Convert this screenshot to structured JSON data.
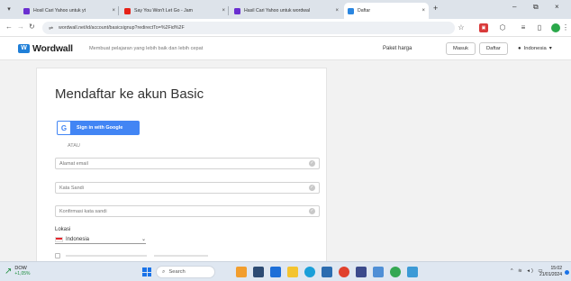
{
  "browser": {
    "tabs": [
      {
        "title": "Hosil Cari Yahoo untuk yt",
        "favicon_color": "#6a2fd0",
        "active": false
      },
      {
        "title": "Say You Won't Let Go - Jam",
        "favicon_color": "#e62117",
        "active": false
      },
      {
        "title": "Hasil Cari Yahoo untuk wordwal",
        "favicon_color": "#6a2fd0",
        "active": false
      },
      {
        "title": "Daftar",
        "favicon_color": "#2a86e0",
        "active": true
      }
    ],
    "new_tab_symbol": "+",
    "url": "wordwall.net/id/account/basicsignup?redirectTo=%2Fid%2F"
  },
  "site": {
    "logo_text": "Wordwall",
    "tagline": "Membuat pelajaran yang lebih baik dan lebih cepat",
    "nav": {
      "pricing": "Paket harga",
      "login": "Masuk",
      "signup": "Daftar",
      "language": "Indonesia"
    }
  },
  "form": {
    "title": "Mendaftar ke akun Basic",
    "google_button": "Sign in with Google",
    "divider": "ATAU",
    "email_placeholder": "Alamat email",
    "password_placeholder": "Kata Sandi",
    "confirm_placeholder": "Konfirmasi kata sandi",
    "location_label": "Lokasi",
    "location_value": "Indonesia"
  },
  "taskbar": {
    "stock_name": "DOW",
    "stock_change": "+1,05%",
    "search_placeholder": "Search",
    "time": "15:02",
    "date": "21/01/2024"
  },
  "colors": {
    "google_blue": "#4285f4",
    "wordwall_blue": "#1f7fd8",
    "stock_green": "#1e8e3e"
  }
}
